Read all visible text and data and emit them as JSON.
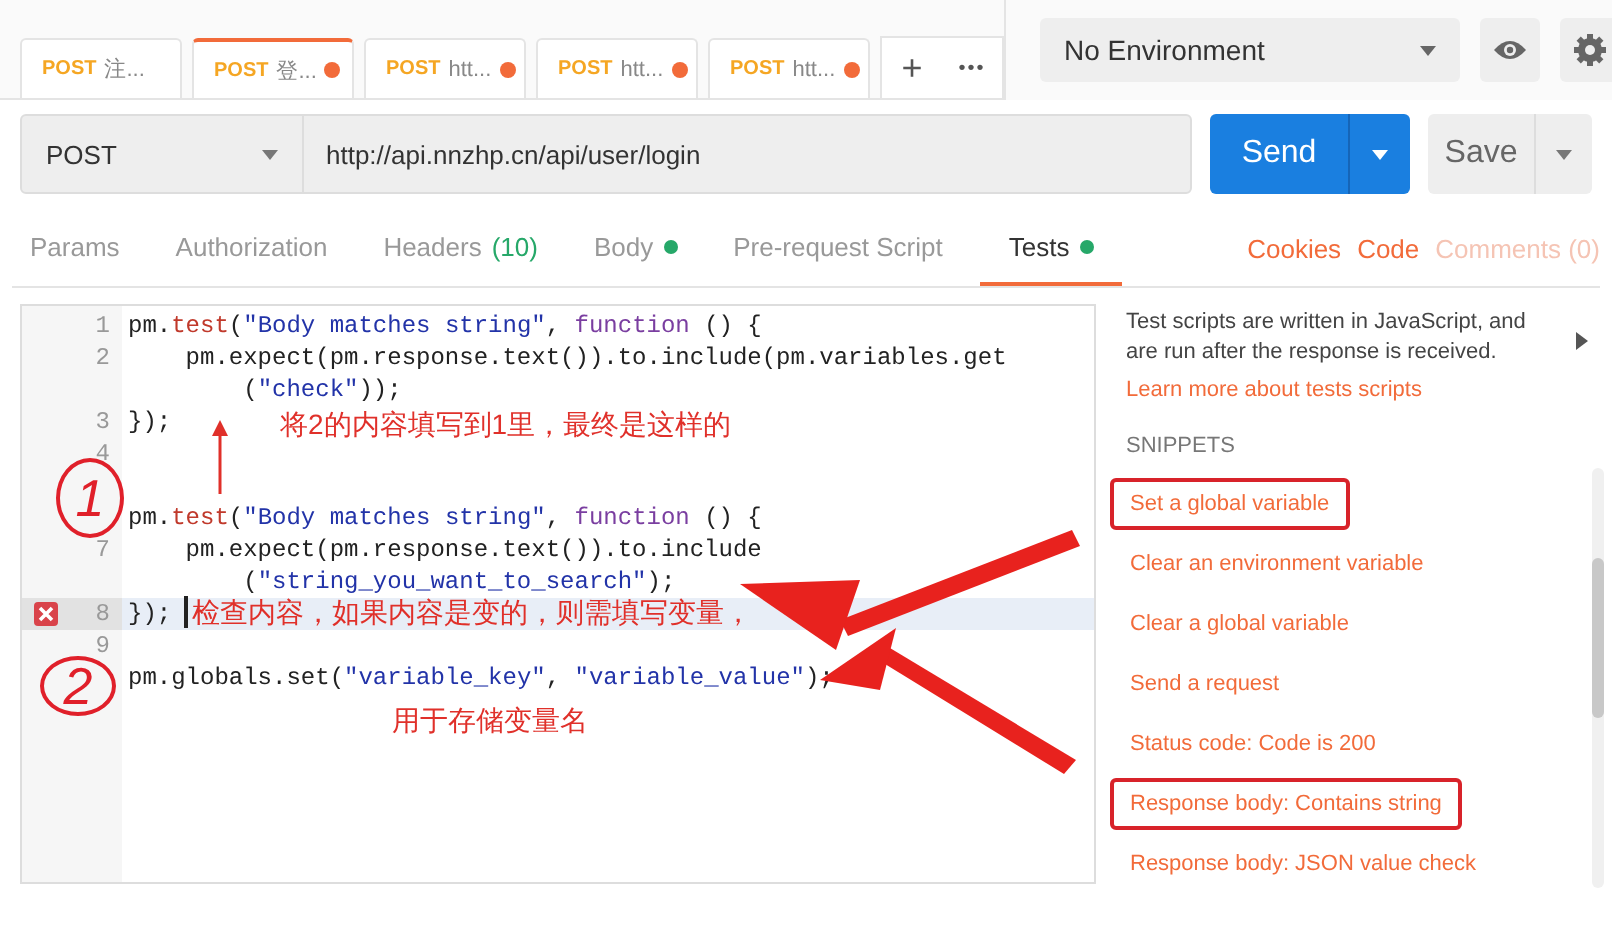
{
  "request_tabs": [
    {
      "method": "POST",
      "name": "注...",
      "unsaved": false,
      "selected": false
    },
    {
      "method": "POST",
      "name": "登...",
      "unsaved": true,
      "selected": true
    },
    {
      "method": "POST",
      "name": "htt...",
      "unsaved": true,
      "selected": false
    },
    {
      "method": "POST",
      "name": "htt...",
      "unsaved": true,
      "selected": false
    },
    {
      "method": "POST",
      "name": "htt...",
      "unsaved": true,
      "selected": false
    }
  ],
  "tab_actions": {
    "add": "+",
    "more": "•••"
  },
  "environment": {
    "value": "No Environment"
  },
  "request": {
    "method": "POST",
    "url": "http://api.nnzhp.cn/api/user/login",
    "send": "Send",
    "save": "Save"
  },
  "section_tabs": [
    {
      "label": "Params",
      "has_content": false,
      "selected": false
    },
    {
      "label": "Authorization",
      "has_content": false,
      "selected": false
    },
    {
      "label": "Headers",
      "count": "(10)",
      "has_content": false,
      "selected": false
    },
    {
      "label": "Body",
      "has_content": true,
      "selected": false
    },
    {
      "label": "Pre-request Script",
      "has_content": false,
      "selected": false
    },
    {
      "label": "Tests",
      "has_content": true,
      "selected": true
    }
  ],
  "section_links": [
    {
      "label": "Cookies",
      "disabled": false
    },
    {
      "label": "Code",
      "disabled": false
    },
    {
      "label": "Comments (0)",
      "disabled": true
    }
  ],
  "editor": {
    "rows": [
      {
        "number": "1",
        "error": false,
        "tokens": [
          {
            "kind": "plain",
            "text": "pm."
          },
          {
            "kind": "method",
            "text": "test"
          },
          {
            "kind": "plain",
            "text": "("
          },
          {
            "kind": "string",
            "text": "\"Body matches string\""
          },
          {
            "kind": "plain",
            "text": ", "
          },
          {
            "kind": "keyword",
            "text": "function"
          },
          {
            "kind": "plain",
            "text": " () {"
          }
        ]
      },
      {
        "number": "2",
        "error": false,
        "tokens": [
          {
            "kind": "plain",
            "text": "    pm.expect(pm.response.text()).to.include(pm.variables.get"
          }
        ]
      },
      {
        "error": false,
        "tokens": [
          {
            "kind": "plain",
            "text": "        ("
          },
          {
            "kind": "string",
            "text": "\"check\""
          },
          {
            "kind": "plain",
            "text": "));"
          }
        ]
      },
      {
        "number": "3",
        "error": false,
        "tokens": [
          {
            "kind": "plain",
            "text": "});"
          }
        ]
      },
      {
        "number": "4",
        "error": false,
        "tokens": []
      },
      {
        "tokens": []
      },
      {
        "error": false,
        "tokens": [
          {
            "kind": "plain",
            "text": "pm."
          },
          {
            "kind": "method",
            "text": "test"
          },
          {
            "kind": "plain",
            "text": "("
          },
          {
            "kind": "string",
            "text": "\"Body matches string\""
          },
          {
            "kind": "plain",
            "text": ", "
          },
          {
            "kind": "keyword",
            "text": "function"
          },
          {
            "kind": "plain",
            "text": " () {"
          }
        ]
      },
      {
        "number": "7",
        "error": false,
        "tokens": [
          {
            "kind": "plain",
            "text": "    pm.expect(pm.response.text()).to.include"
          }
        ]
      },
      {
        "error": false,
        "tokens": [
          {
            "kind": "plain",
            "text": "        ("
          },
          {
            "kind": "string",
            "text": "\"string_you_want_to_search\""
          },
          {
            "kind": "plain",
            "text": ");"
          }
        ]
      },
      {
        "number": "8",
        "error": true,
        "tokens": [
          {
            "kind": "plain",
            "text": "});"
          }
        ]
      },
      {
        "number": "9",
        "error": false,
        "tokens": []
      },
      {
        "error": false,
        "tokens": [
          {
            "kind": "plain",
            "text": "pm.globals.set("
          },
          {
            "kind": "string",
            "text": "\"variable_key\""
          },
          {
            "kind": "plain",
            "text": ", "
          },
          {
            "kind": "string",
            "text": "\"variable_value\""
          },
          {
            "kind": "plain",
            "text": ");"
          }
        ]
      }
    ]
  },
  "annotations": {
    "notes": [
      "将2的内容填写到1里，最终是这样的",
      "检查内容，如果内容是变的，则需填写变量，",
      "用于存储变量名"
    ],
    "circled": [
      "1",
      "2"
    ]
  },
  "side_panel": {
    "description": "Test scripts are written in JavaScript, and are run after the response is received.",
    "learn_more": "Learn more about tests scripts",
    "snippets_title": "SNIPPETS",
    "snippets": [
      {
        "label": "Set a global variable",
        "highlighted": true
      },
      {
        "label": "Clear an environment variable",
        "highlighted": false
      },
      {
        "label": "Clear a global variable",
        "highlighted": false
      },
      {
        "label": "Send a request",
        "highlighted": false
      },
      {
        "label": "Status code: Code is 200",
        "highlighted": false
      },
      {
        "label": "Response body: Contains string",
        "highlighted": true
      },
      {
        "label": "Response body: JSON value check",
        "highlighted": false
      }
    ]
  }
}
